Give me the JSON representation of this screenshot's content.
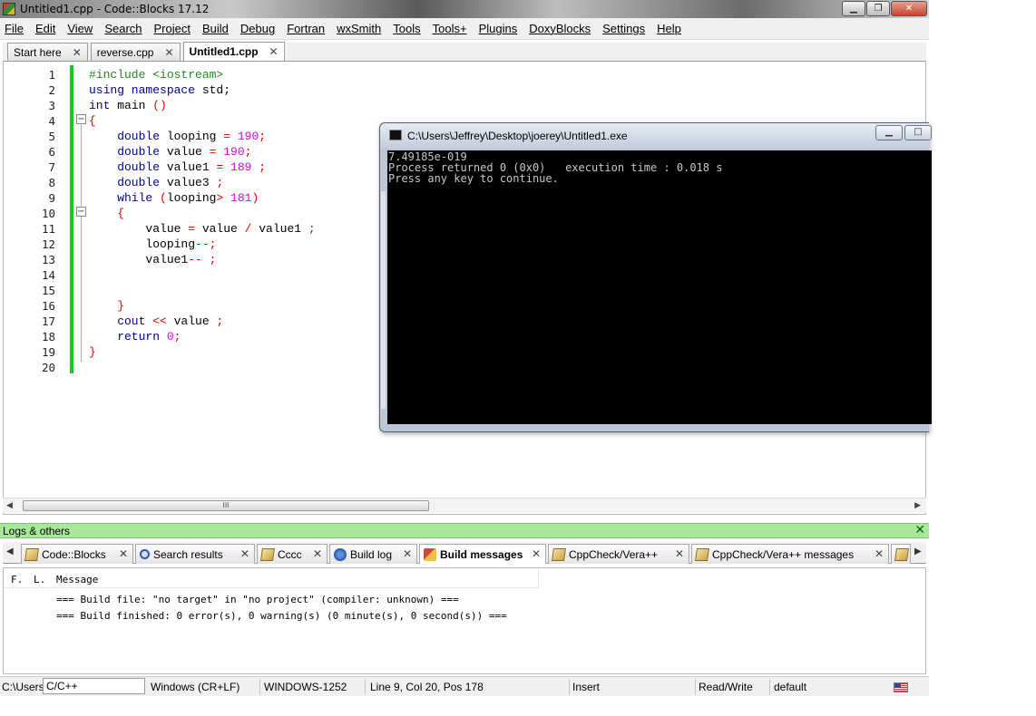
{
  "window": {
    "title": "Untitled1.cpp - Code::Blocks 17.12",
    "min_glyph": "▁",
    "max_glyph": "❐",
    "close_glyph": "✕"
  },
  "menu": [
    "File",
    "Edit",
    "View",
    "Search",
    "Project",
    "Build",
    "Debug",
    "Fortran",
    "wxSmith",
    "Tools",
    "Tools+",
    "Plugins",
    "DoxyBlocks",
    "Settings",
    "Help"
  ],
  "editor_tabs": [
    {
      "label": "Start here",
      "active": false
    },
    {
      "label": "reverse.cpp",
      "active": false
    },
    {
      "label": "Untitled1.cpp",
      "active": true
    }
  ],
  "tab_close_glyph": "✕",
  "fold_collapse_glyph": "−",
  "line_numbers": [
    "1",
    "2",
    "3",
    "4",
    "5",
    "6",
    "7",
    "8",
    "9",
    "10",
    "11",
    "12",
    "13",
    "14",
    "15",
    "16",
    "17",
    "18",
    "19",
    "20"
  ],
  "code_lines": [
    [
      {
        "t": "#include <iostream>",
        "c": "pp"
      }
    ],
    [
      {
        "t": "using namespace ",
        "c": "kw"
      },
      {
        "t": "std;",
        "c": "plain"
      }
    ],
    [
      {
        "t": "int ",
        "c": "kw"
      },
      {
        "t": "main ",
        "c": "plain"
      },
      {
        "t": "()",
        "c": "op"
      }
    ],
    [
      {
        "t": "{",
        "c": "op"
      }
    ],
    [
      {
        "t": "    double ",
        "c": "kw"
      },
      {
        "t": "looping ",
        "c": "plain"
      },
      {
        "t": "= ",
        "c": "op"
      },
      {
        "t": "190",
        "c": "num"
      },
      {
        "t": ";",
        "c": "op"
      }
    ],
    [
      {
        "t": "    double ",
        "c": "kw"
      },
      {
        "t": "value ",
        "c": "plain"
      },
      {
        "t": "= ",
        "c": "op"
      },
      {
        "t": "190",
        "c": "num"
      },
      {
        "t": ";",
        "c": "op"
      }
    ],
    [
      {
        "t": "    double ",
        "c": "kw"
      },
      {
        "t": "value1 ",
        "c": "plain"
      },
      {
        "t": "= ",
        "c": "op"
      },
      {
        "t": "189 ",
        "c": "num"
      },
      {
        "t": ";",
        "c": "op"
      }
    ],
    [
      {
        "t": "    double ",
        "c": "kw"
      },
      {
        "t": "value3 ",
        "c": "plain"
      },
      {
        "t": ";",
        "c": "op"
      }
    ],
    [
      {
        "t": "    while ",
        "c": "kw"
      },
      {
        "t": "(",
        "c": "op"
      },
      {
        "t": "looping",
        "c": "plain"
      },
      {
        "t": "> ",
        "c": "op"
      },
      {
        "t": "181",
        "c": "num"
      },
      {
        "t": ")",
        "c": "op"
      }
    ],
    [
      {
        "t": "    {",
        "c": "op"
      }
    ],
    [
      {
        "t": "        value ",
        "c": "plain"
      },
      {
        "t": "= ",
        "c": "op"
      },
      {
        "t": "value ",
        "c": "plain"
      },
      {
        "t": "/ ",
        "c": "op"
      },
      {
        "t": "value1 ",
        "c": "plain"
      },
      {
        "t": ";",
        "c": "op"
      }
    ],
    [
      {
        "t": "        looping",
        "c": "plain"
      },
      {
        "t": "--;",
        "c": "op"
      }
    ],
    [
      {
        "t": "        value1",
        "c": "plain"
      },
      {
        "t": "-- ;",
        "c": "op"
      }
    ],
    [],
    [],
    [
      {
        "t": "    }",
        "c": "op"
      }
    ],
    [
      {
        "t": "    cout ",
        "c": "kw"
      },
      {
        "t": "<< ",
        "c": "op"
      },
      {
        "t": "value ",
        "c": "plain"
      },
      {
        "t": ";",
        "c": "op"
      }
    ],
    [
      {
        "t": "    return ",
        "c": "kw"
      },
      {
        "t": "0",
        "c": "num"
      },
      {
        "t": ";",
        "c": "op"
      }
    ],
    [
      {
        "t": "}",
        "c": "op"
      }
    ],
    []
  ],
  "hscroll_thumb_glyph": "III",
  "hscroll_left_glyph": "◀",
  "hscroll_right_glyph": "▶",
  "console": {
    "title": "C:\\Users\\Jeffrey\\Desktop\\joerey\\Untitled1.exe",
    "output": "7.49185e-019\nProcess returned 0 (0x0)   execution time : 0.018 s\nPress any key to continue.",
    "min_glyph": "▁",
    "max_glyph": "□"
  },
  "logs": {
    "title": "Logs & others",
    "close_glyph": "✕",
    "left_arrow": "◀",
    "right_arrow": "▶",
    "tabs": [
      {
        "label": "Code::Blocks",
        "icon": "note-icon",
        "active": false
      },
      {
        "label": "Search results",
        "icon": "search-icon",
        "active": false
      },
      {
        "label": "Cccc",
        "icon": "note-icon",
        "active": false
      },
      {
        "label": "Build log",
        "icon": "gear-icon",
        "active": false
      },
      {
        "label": "Build messages",
        "icon": "build-messages-icon",
        "active": true
      },
      {
        "label": "CppCheck/Vera++",
        "icon": "note-icon",
        "active": false
      },
      {
        "label": "CppCheck/Vera++ messages",
        "icon": "note-icon",
        "active": false
      }
    ],
    "columns": [
      "F.",
      "L.",
      "Message"
    ],
    "messages": [
      "=== Build file: \"no target\" in \"no project\" (compiler: unknown) ===",
      "=== Build finished: 0 error(s), 0 warning(s) (0 minute(s), 0 second(s)) ==="
    ]
  },
  "status": {
    "path_fragment": "C:\\Users",
    "language": "C/C++",
    "eol": "Windows (CR+LF)",
    "encoding": "WINDOWS-1252",
    "position": "Line 9, Col 20, Pos 178",
    "mode": "Insert",
    "access": "Read/Write",
    "profile": "default"
  }
}
